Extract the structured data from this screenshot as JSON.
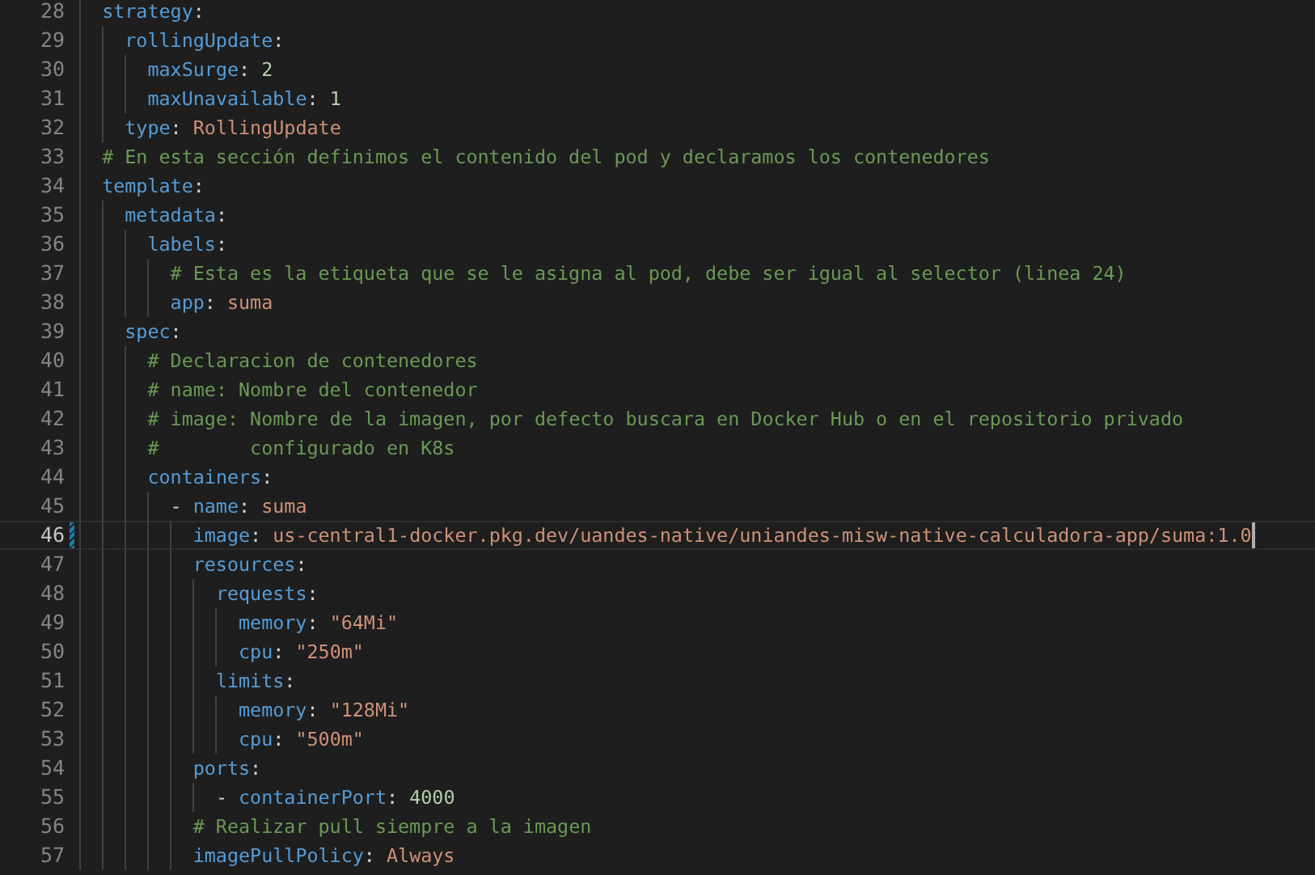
{
  "editor": {
    "lines": [
      {
        "number": "28",
        "current": false,
        "modified": false,
        "tokens": [
          {
            "kind": "key",
            "text": "strategy"
          },
          {
            "kind": "punct",
            "text": ":"
          }
        ],
        "children": [
          {
            "number": "29",
            "current": false,
            "modified": false,
            "tokens": [
              {
                "kind": "key",
                "text": "rollingUpdate"
              },
              {
                "kind": "punct",
                "text": ":"
              }
            ],
            "children": [
              {
                "number": "30",
                "current": false,
                "modified": false,
                "tokens": [
                  {
                    "kind": "key",
                    "text": "maxSurge"
                  },
                  {
                    "kind": "punct",
                    "text": ": "
                  },
                  {
                    "kind": "number",
                    "text": "2"
                  }
                ]
              },
              {
                "number": "31",
                "current": false,
                "modified": false,
                "tokens": [
                  {
                    "kind": "key",
                    "text": "maxUnavailable"
                  },
                  {
                    "kind": "punct",
                    "text": ": "
                  },
                  {
                    "kind": "number",
                    "text": "1"
                  }
                ]
              }
            ]
          },
          {
            "number": "32",
            "current": false,
            "modified": false,
            "tokens": [
              {
                "kind": "key",
                "text": "type"
              },
              {
                "kind": "punct",
                "text": ": "
              },
              {
                "kind": "string",
                "text": "RollingUpdate"
              }
            ]
          }
        ]
      },
      {
        "number": "33",
        "current": false,
        "modified": false,
        "tokens": [
          {
            "kind": "comment",
            "text": "# En esta sección definimos el contenido del pod y declaramos los contenedores"
          }
        ]
      },
      {
        "number": "34",
        "current": false,
        "modified": false,
        "tokens": [
          {
            "kind": "key",
            "text": "template"
          },
          {
            "kind": "punct",
            "text": ":"
          }
        ],
        "children": [
          {
            "number": "35",
            "current": false,
            "modified": false,
            "tokens": [
              {
                "kind": "key",
                "text": "metadata"
              },
              {
                "kind": "punct",
                "text": ":"
              }
            ],
            "children": [
              {
                "number": "36",
                "current": false,
                "modified": false,
                "tokens": [
                  {
                    "kind": "key",
                    "text": "labels"
                  },
                  {
                    "kind": "punct",
                    "text": ":"
                  }
                ],
                "children": [
                  {
                    "number": "37",
                    "current": false,
                    "modified": false,
                    "tokens": [
                      {
                        "kind": "comment",
                        "text": "# Esta es la etiqueta que se le asigna al pod, debe ser igual al selector (linea 24)"
                      }
                    ]
                  },
                  {
                    "number": "38",
                    "current": false,
                    "modified": false,
                    "tokens": [
                      {
                        "kind": "key",
                        "text": "app"
                      },
                      {
                        "kind": "punct",
                        "text": ": "
                      },
                      {
                        "kind": "string",
                        "text": "suma"
                      }
                    ]
                  }
                ]
              }
            ]
          },
          {
            "number": "39",
            "current": false,
            "modified": false,
            "tokens": [
              {
                "kind": "key",
                "text": "spec"
              },
              {
                "kind": "punct",
                "text": ":"
              }
            ],
            "children": [
              {
                "number": "40",
                "current": false,
                "modified": false,
                "tokens": [
                  {
                    "kind": "comment",
                    "text": "# Declaracion de contenedores"
                  }
                ]
              },
              {
                "number": "41",
                "current": false,
                "modified": false,
                "tokens": [
                  {
                    "kind": "comment",
                    "text": "# name: Nombre del contenedor"
                  }
                ]
              },
              {
                "number": "42",
                "current": false,
                "modified": false,
                "tokens": [
                  {
                    "kind": "comment",
                    "text": "# image: Nombre de la imagen, por defecto buscara en Docker Hub o en el repositorio privado"
                  }
                ]
              },
              {
                "number": "43",
                "current": false,
                "modified": false,
                "tokens": [
                  {
                    "kind": "comment",
                    "text": "#        configurado en K8s"
                  }
                ]
              },
              {
                "number": "44",
                "current": false,
                "modified": false,
                "tokens": [
                  {
                    "kind": "key",
                    "text": "containers"
                  },
                  {
                    "kind": "punct",
                    "text": ":"
                  }
                ],
                "children": [
                  {
                    "number": "45",
                    "current": false,
                    "modified": false,
                    "tokens": [
                      {
                        "kind": "punct",
                        "text": "- "
                      },
                      {
                        "kind": "key",
                        "text": "name"
                      },
                      {
                        "kind": "punct",
                        "text": ": "
                      },
                      {
                        "kind": "string",
                        "text": "suma"
                      }
                    ],
                    "children": [
                      {
                        "number": "46",
                        "current": true,
                        "modified": true,
                        "tokens": [
                          {
                            "kind": "key",
                            "text": "image"
                          },
                          {
                            "kind": "punct",
                            "text": ": "
                          },
                          {
                            "kind": "string",
                            "text": "us-central1-docker.pkg.dev/uandes-native/uniandes-misw-native-calculadora-app/suma:1.0"
                          }
                        ]
                      },
                      {
                        "number": "47",
                        "current": false,
                        "modified": false,
                        "tokens": [
                          {
                            "kind": "key",
                            "text": "resources"
                          },
                          {
                            "kind": "punct",
                            "text": ":"
                          }
                        ],
                        "children": [
                          {
                            "number": "48",
                            "current": false,
                            "modified": false,
                            "tokens": [
                              {
                                "kind": "key",
                                "text": "requests"
                              },
                              {
                                "kind": "punct",
                                "text": ":"
                              }
                            ],
                            "children": [
                              {
                                "number": "49",
                                "current": false,
                                "modified": false,
                                "tokens": [
                                  {
                                    "kind": "key",
                                    "text": "memory"
                                  },
                                  {
                                    "kind": "punct",
                                    "text": ": "
                                  },
                                  {
                                    "kind": "string",
                                    "text": "\"64Mi\""
                                  }
                                ]
                              },
                              {
                                "number": "50",
                                "current": false,
                                "modified": false,
                                "tokens": [
                                  {
                                    "kind": "key",
                                    "text": "cpu"
                                  },
                                  {
                                    "kind": "punct",
                                    "text": ": "
                                  },
                                  {
                                    "kind": "string",
                                    "text": "\"250m\""
                                  }
                                ]
                              }
                            ]
                          },
                          {
                            "number": "51",
                            "current": false,
                            "modified": false,
                            "tokens": [
                              {
                                "kind": "key",
                                "text": "limits"
                              },
                              {
                                "kind": "punct",
                                "text": ":"
                              }
                            ],
                            "children": [
                              {
                                "number": "52",
                                "current": false,
                                "modified": false,
                                "tokens": [
                                  {
                                    "kind": "key",
                                    "text": "memory"
                                  },
                                  {
                                    "kind": "punct",
                                    "text": ": "
                                  },
                                  {
                                    "kind": "string",
                                    "text": "\"128Mi\""
                                  }
                                ]
                              },
                              {
                                "number": "53",
                                "current": false,
                                "modified": false,
                                "tokens": [
                                  {
                                    "kind": "key",
                                    "text": "cpu"
                                  },
                                  {
                                    "kind": "punct",
                                    "text": ": "
                                  },
                                  {
                                    "kind": "string",
                                    "text": "\"500m\""
                                  }
                                ]
                              }
                            ]
                          }
                        ]
                      },
                      {
                        "number": "54",
                        "current": false,
                        "modified": false,
                        "tokens": [
                          {
                            "kind": "key",
                            "text": "ports"
                          },
                          {
                            "kind": "punct",
                            "text": ":"
                          }
                        ],
                        "children": [
                          {
                            "number": "55",
                            "current": false,
                            "modified": false,
                            "tokens": [
                              {
                                "kind": "punct",
                                "text": "- "
                              },
                              {
                                "kind": "key",
                                "text": "containerPort"
                              },
                              {
                                "kind": "punct",
                                "text": ": "
                              },
                              {
                                "kind": "number",
                                "text": "4000"
                              }
                            ]
                          }
                        ]
                      },
                      {
                        "number": "56",
                        "current": false,
                        "modified": false,
                        "tokens": [
                          {
                            "kind": "comment",
                            "text": "# Realizar pull siempre a la imagen"
                          }
                        ]
                      },
                      {
                        "number": "57",
                        "current": false,
                        "modified": false,
                        "tokens": [
                          {
                            "kind": "key",
                            "text": "imagePullPolicy"
                          },
                          {
                            "kind": "punct",
                            "text": ": "
                          },
                          {
                            "kind": "string",
                            "text": "Always"
                          }
                        ]
                      }
                    ]
                  }
                ]
              }
            ]
          }
        ]
      }
    ]
  }
}
